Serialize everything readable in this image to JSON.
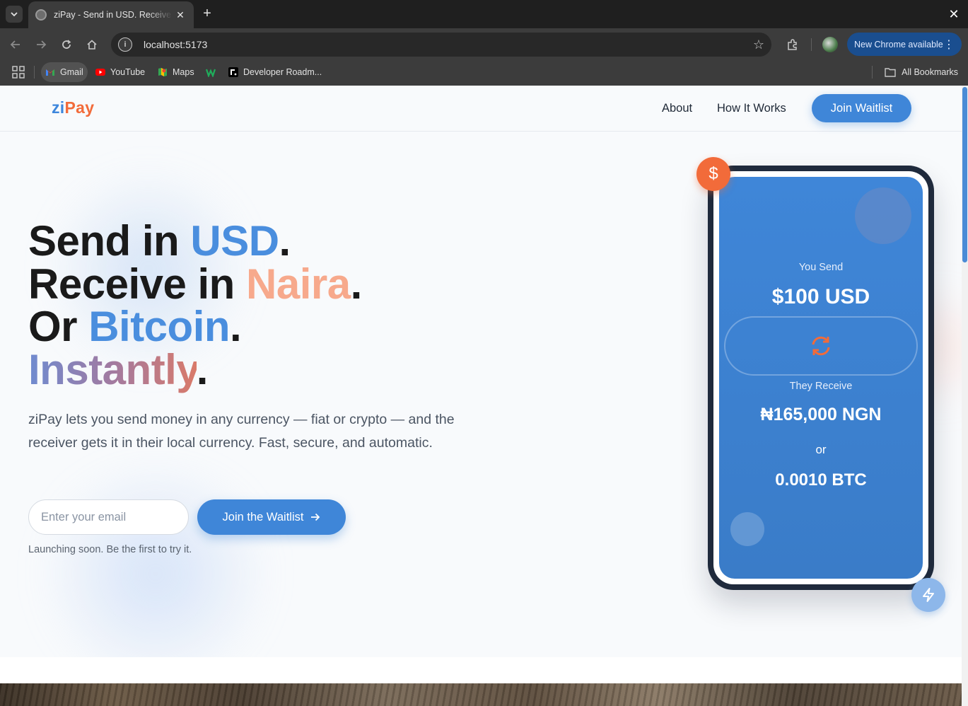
{
  "browser": {
    "tab_title": "ziPay - Send in USD. Receive in Naira. Or Bitcoin. Instantly.",
    "url": "localhost:5173",
    "update_label": "New Chrome available",
    "bookmarks": [
      {
        "label": "Gmail"
      },
      {
        "label": "YouTube"
      },
      {
        "label": "Maps"
      },
      {
        "label": ""
      },
      {
        "label": "Developer Roadm..."
      }
    ],
    "all_bookmarks_label": "All Bookmarks"
  },
  "header": {
    "logo_part1": "zi",
    "logo_part2": "Pay",
    "nav": [
      "About",
      "How It Works"
    ],
    "cta_label": "Join Waitlist"
  },
  "hero": {
    "line1_prefix": "Send in ",
    "line1_accent": "USD",
    "line2_prefix": "Receive in ",
    "line2_accent": "Naira",
    "line3_prefix": "Or ",
    "line3_accent": "Bitcoin",
    "line4_accent": "Instantly",
    "period": ".",
    "subtext": "ziPay lets you send money in any currency — fiat or crypto — and the receiver gets it in their local currency. Fast, secure, and automatic.",
    "email_placeholder": "Enter your email",
    "email_value": "",
    "cta_label": "Join the Waitlist",
    "note": "Launching soon. Be the first to try it."
  },
  "phone": {
    "send_label": "You Send",
    "send_amount": "$100 USD",
    "receive_label": "They Receive",
    "receive_amount": "₦165,000 NGN",
    "or_label": "or",
    "btc_amount": "0.0010 BTC",
    "dollar_badge": "$"
  },
  "colors": {
    "brand_blue": "#3f86d8",
    "brand_orange": "#f26b3a",
    "naira_peach": "#f7a98c"
  }
}
